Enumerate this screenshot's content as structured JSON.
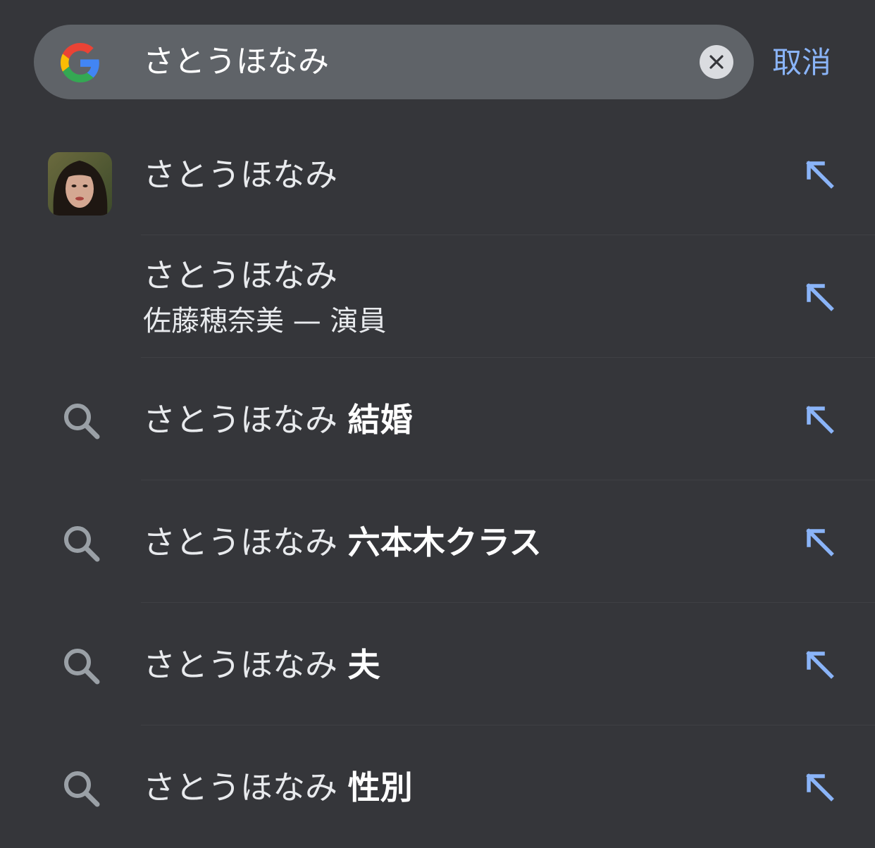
{
  "search": {
    "value": "さとうほなみ",
    "cancel_label": "取消"
  },
  "colors": {
    "background": "#35363a",
    "search_bar": "#5f6368",
    "accent": "#8ab4f8",
    "text": "#e8eaed",
    "icon_gray": "#9aa0a6"
  },
  "suggestions": [
    {
      "type": "history",
      "icon": "history-icon",
      "base": "さとうほなみ",
      "suffix": ""
    },
    {
      "type": "entity",
      "icon": "avatar",
      "title": "さとうほなみ",
      "subtitle": "佐藤穂奈美 — 演員"
    },
    {
      "type": "search",
      "icon": "search-icon",
      "base": "さとうほなみ",
      "suffix": "結婚"
    },
    {
      "type": "search",
      "icon": "search-icon",
      "base": "さとうほなみ",
      "suffix": "六本木クラス"
    },
    {
      "type": "search",
      "icon": "search-icon",
      "base": "さとうほなみ",
      "suffix": "夫"
    },
    {
      "type": "search",
      "icon": "search-icon",
      "base": "さとうほなみ",
      "suffix": "性別"
    }
  ]
}
